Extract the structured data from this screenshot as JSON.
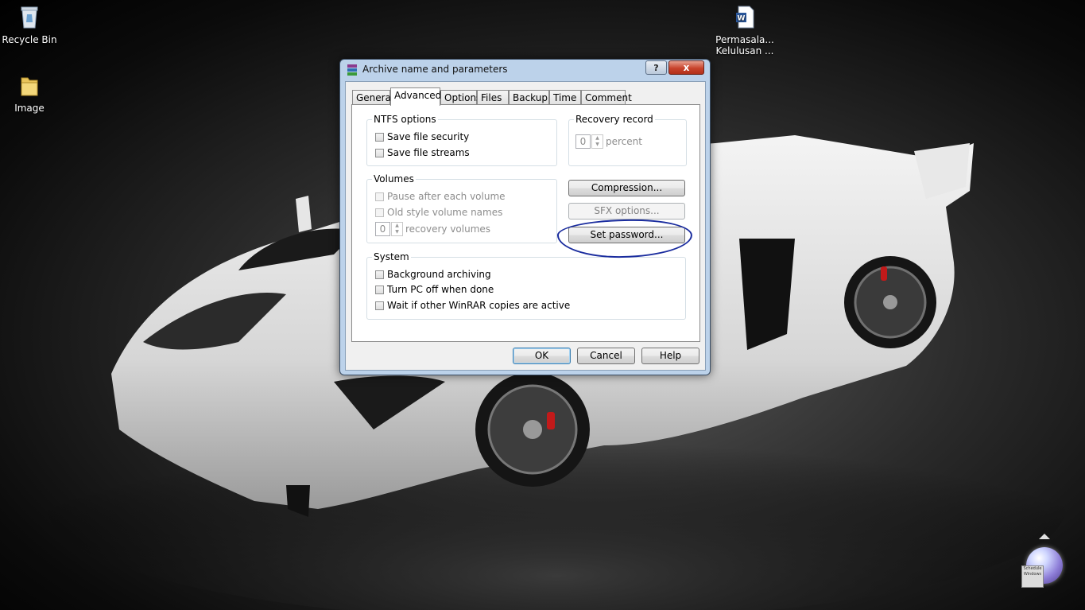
{
  "desktop": {
    "icons": [
      {
        "label": "Recycle Bin",
        "icon": "recycle-bin-icon"
      },
      {
        "label": "Image",
        "icon": "folder-icon"
      },
      {
        "label_line1": "Permasala...",
        "label_line2": "Kelulusan ...",
        "icon": "word-document-icon"
      }
    ],
    "gadget_text": "Schedule Windows"
  },
  "dialog": {
    "title": "Archive name and parameters",
    "help_button": "?",
    "close_button": "x",
    "tabs": [
      "General",
      "Advanced",
      "Options",
      "Files",
      "Backup",
      "Time",
      "Comment"
    ],
    "active_tab": "Advanced",
    "ntfs": {
      "title": "NTFS options",
      "save_security": "Save file security",
      "save_streams": "Save file streams"
    },
    "recovery": {
      "title": "Recovery record",
      "value": "0",
      "unit": "percent"
    },
    "volumes": {
      "title": "Volumes",
      "pause": "Pause after each volume",
      "old_style": "Old style volume names",
      "recovery_value": "0",
      "recovery_label": "recovery volumes"
    },
    "buttons": {
      "compression": "Compression...",
      "sfx": "SFX options...",
      "set_password": "Set password..."
    },
    "system": {
      "title": "System",
      "background": "Background archiving",
      "turn_off": "Turn PC off when done",
      "wait": "Wait if other WinRAR copies are active"
    },
    "footer": {
      "ok": "OK",
      "cancel": "Cancel",
      "help": "Help"
    }
  },
  "colors": {
    "annotation": "#1a2c9e",
    "title_bg": "#bcd2ea",
    "close_red": "#c8432c"
  }
}
